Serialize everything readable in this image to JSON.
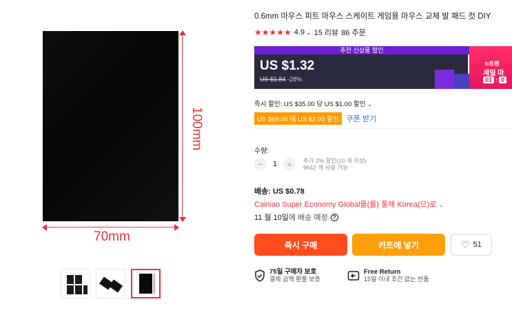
{
  "product": {
    "title": "0.6mm 마우스 피트 마우스 스케이트 게임용 마우스 교체 발 패드 컷 DIY",
    "rating_stars": "★★★★★",
    "rating_value": "4.9",
    "rating_chevron": "⌄",
    "reviews": "15 리뷰",
    "orders": "86 주문"
  },
  "image": {
    "dim_vertical_label": "100mm",
    "dim_horizontal_label": "70mm",
    "accent_color": "#e8323b"
  },
  "promo": {
    "banner_text": "추천 신상품 할인",
    "price": "US $1.32",
    "old_price": "US $1.84",
    "discount": "-28%",
    "badge_brand": "⊙트렌",
    "badge_sale": "세일 마",
    "timer_hours": "01",
    "timer_sep": ":",
    "timer_next": "0"
  },
  "discounts": {
    "instant_text": "즉시 할인: US $35.00 당 US $1.00 할인",
    "instant_chevron": "⌄",
    "coupon_tag": "US $69.00 에 US $2.00 할인",
    "coupon_link": "쿠폰 받기"
  },
  "quantity": {
    "label": "수량:",
    "minus": "−",
    "value": "1",
    "plus": "+",
    "note_line1": "추가 2% 할인(10 개 이상)",
    "note_line2": "9642 개 사용 가능"
  },
  "shipping": {
    "title": "배송: US $0.78",
    "via": "Cainiao Super Economy Global을(를) 통해 Korea(으)로",
    "via_chevron": "⌄",
    "date_bold": "11 월 10일",
    "date_rest": "에 배송 예정",
    "help_icon": "?"
  },
  "actions": {
    "buy_now": "즉시 구매",
    "add_to_cart": "카트에 넣기",
    "wishlist_icon": "♡",
    "wishlist_count": "51"
  },
  "features": [
    {
      "icon": "shield-check-icon",
      "title": "75일 구매자 보호",
      "subtitle": "결제 금액 환불 보증"
    },
    {
      "icon": "return-icon",
      "title": "Free Return",
      "subtitle": "15일 이내 조건 없는 반품"
    }
  ]
}
